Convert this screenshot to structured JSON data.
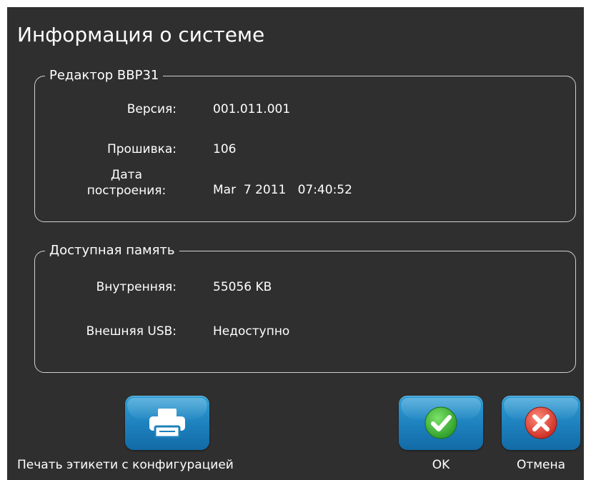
{
  "window": {
    "title": "Информация о системе"
  },
  "editor_group": {
    "legend": "Редактор BBP31",
    "rows": [
      {
        "label": "Версия:",
        "value": "001.011.001"
      },
      {
        "label": "Прошивка:",
        "value": "106"
      },
      {
        "label_line1": "Дата",
        "label_line2": "построения:",
        "value": "Mar  7 2011   07:40:52"
      }
    ]
  },
  "memory_group": {
    "legend": "Доступная память",
    "rows": [
      {
        "label": "Внутренняя:",
        "value": "55056 KB"
      },
      {
        "label": "Внешняя USB:",
        "value": "Недоступно"
      }
    ]
  },
  "buttons": {
    "print_label": "Печать этикети с конфигурацией",
    "ok_label": "OK",
    "cancel_label": "Отмена"
  },
  "icons": {
    "print": "printer-icon",
    "ok": "checkmark-icon",
    "cancel": "close-icon"
  },
  "colors": {
    "background": "#2f2f2f",
    "button_blue": "#1d80bd",
    "ok_green": "#3cb43c",
    "cancel_red": "#e0473a"
  }
}
